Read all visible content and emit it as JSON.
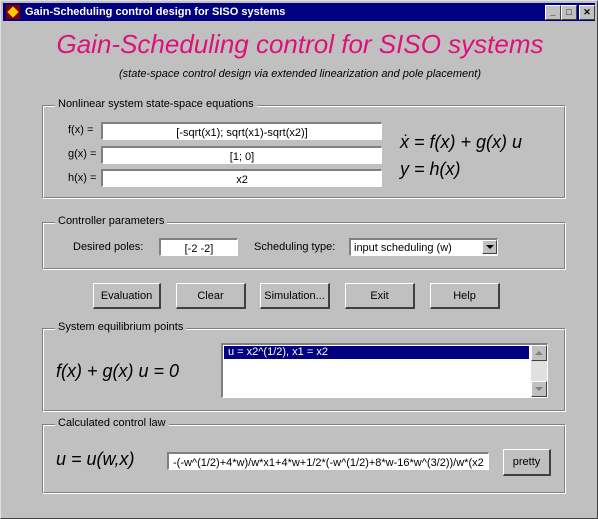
{
  "window": {
    "title": "Gain-Scheduling control design for SISO systems",
    "minimize_glyph": "_",
    "maximize_glyph": "□",
    "close_glyph": "✕"
  },
  "header": {
    "title": "Gain-Scheduling control for SISO systems",
    "subtitle": "(state-space control design via extended linearization and pole placement)"
  },
  "equations_group": {
    "label": "Nonlinear system state-space equations",
    "fx_label": "f(x) =",
    "fx_value": "[-sqrt(x1); sqrt(x1)-sqrt(x2)]",
    "gx_label": "g(x) =",
    "gx_value": "[1; 0]",
    "hx_label": "h(x) =",
    "hx_value": "x2",
    "eq1": "ẋ = f(x) + g(x) u",
    "eq2": "y = h(x)"
  },
  "controller_group": {
    "label": "Controller parameters",
    "poles_label": "Desired poles:",
    "poles_value": "[-2 -2]",
    "scheduling_label": "Scheduling type:",
    "scheduling_value": "input scheduling (w)"
  },
  "buttons": {
    "evaluation": "Evaluation",
    "clear": "Clear",
    "simulation": "Simulation...",
    "exit": "Exit",
    "help": "Help"
  },
  "equilibrium_group": {
    "label": "System equilibrium points",
    "equation": "f(x) + g(x) u = 0",
    "items": [
      "u = x2^(1/2), x1 = x2"
    ]
  },
  "control_law_group": {
    "label": "Calculated control law",
    "equation": "u = u(w,x)",
    "value": "-(-w^(1/2)+4*w)/w*x1+4*w+1/2*(-w^(1/2)+8*w-16*w^(3/2))/w*(x2",
    "pretty_button": "pretty"
  },
  "colors": {
    "title_magenta": "#e0107a",
    "titlebar_blue": "#000080",
    "face_gray": "#c0c0c0"
  }
}
